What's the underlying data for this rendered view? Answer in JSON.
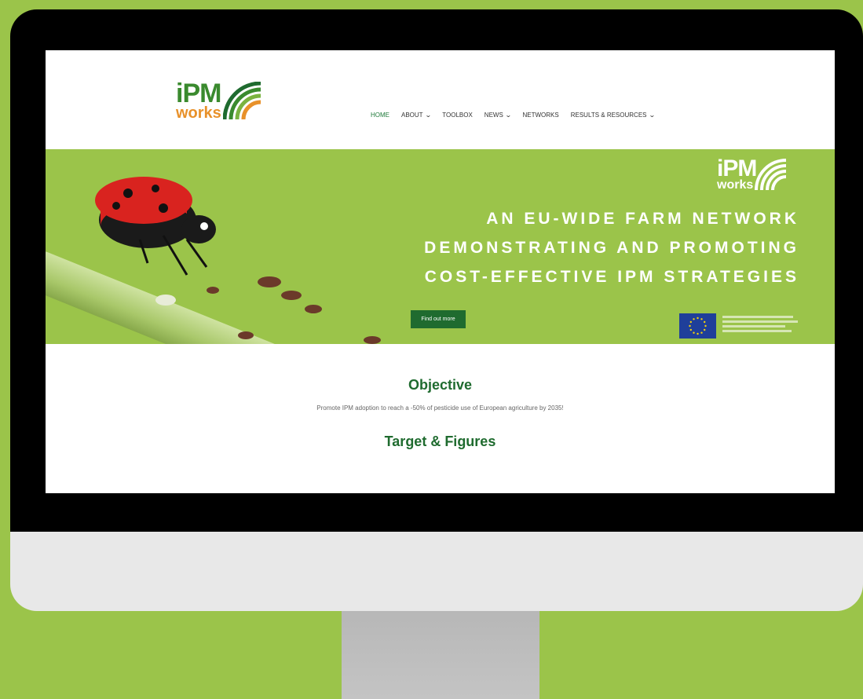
{
  "site": {
    "logo_top": "iPM",
    "logo_bottom": "works"
  },
  "nav": {
    "items": [
      {
        "label": "HOME",
        "has_dropdown": false,
        "active": true
      },
      {
        "label": "ABOUT",
        "has_dropdown": true,
        "active": false
      },
      {
        "label": "TOOLBOX",
        "has_dropdown": false,
        "active": false
      },
      {
        "label": "NEWS",
        "has_dropdown": true,
        "active": false
      },
      {
        "label": "NETWORKS",
        "has_dropdown": false,
        "active": false
      },
      {
        "label": "RESULTS & RESOURCES",
        "has_dropdown": true,
        "active": false
      }
    ]
  },
  "hero": {
    "headline_lines": [
      "AN EU-WIDE FARM NETWORK",
      "DEMONSTRATING AND PROMOTING",
      "COST-EFFECTIVE IPM STRATEGIES"
    ],
    "button_label": "Find out more",
    "logo_top": "iPM",
    "logo_bottom": "works"
  },
  "content": {
    "objective_title": "Objective",
    "objective_text": "Promote IPM adoption to reach a -50% of pesticide use of European agriculture by 2035!",
    "targets_title": "Target & Figures"
  },
  "colors": {
    "background_green": "#9bc44a",
    "brand_dark_green": "#1f6b2f",
    "logo_orange": "#e8912a"
  }
}
